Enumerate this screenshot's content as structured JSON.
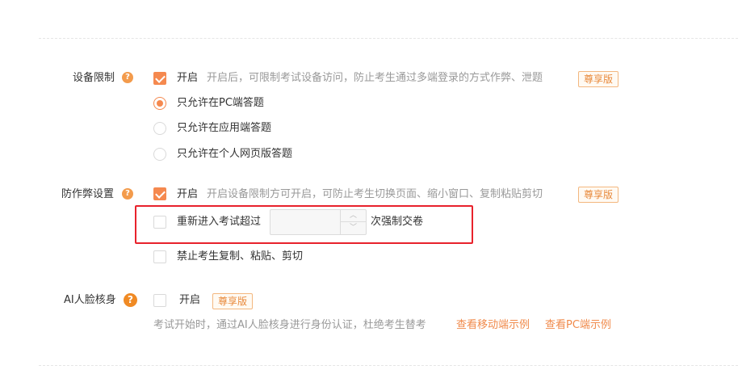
{
  "device_limit": {
    "label": "设备限制",
    "help": "?",
    "enable_label": "开启",
    "description": "开启后，可限制考试设备访问，防止考生通过多端登录的方式作弊、泄题",
    "badge": "尊享版",
    "enabled": true,
    "options": [
      {
        "label": "只允许在PC端答题",
        "selected": true
      },
      {
        "label": "只允许在应用端答题",
        "selected": false
      },
      {
        "label": "只允许在个人网页版答题",
        "selected": false
      }
    ]
  },
  "anti_cheat": {
    "label": "防作弊设置",
    "help": "?",
    "enable_label": "开启",
    "description": "开启设备限制方可开启，可防止考生切换页面、缩小窗口、复制粘贴剪切",
    "badge": "尊享版",
    "enabled": true,
    "reenter": {
      "prefix": "重新进入考试超过",
      "value": "",
      "suffix": "次强制交卷",
      "checked": false
    },
    "no_copy": {
      "label": "禁止考生复制、粘贴、剪切",
      "checked": false
    }
  },
  "ai_face": {
    "label": "AI人脸核身",
    "help": "?",
    "enable_label": "开启",
    "badge": "尊享版",
    "enabled": false,
    "description": "考试开始时，通过AI人脸核身进行身份认证，杜绝考生替考",
    "link_mobile": "查看移动端示例",
    "link_pc": "查看PC端示例"
  },
  "colors": {
    "accent": "#f5894f",
    "highlight_border": "#e8222c",
    "badge_text": "#e8893b"
  }
}
